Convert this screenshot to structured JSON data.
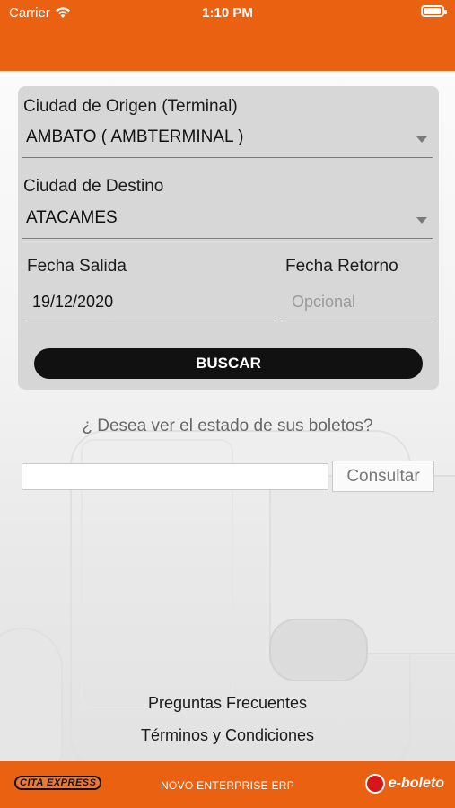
{
  "status_bar": {
    "carrier": "Carrier",
    "time": "1:10 PM",
    "battery_level": 0.95
  },
  "form": {
    "origin_label": "Ciudad de Origen (Terminal)",
    "origin_value": "AMBATO ( AMBTERMINAL )",
    "destination_label": "Ciudad de Destino",
    "destination_value": "ATACAMES",
    "departure_label": "Fecha Salida",
    "departure_value": "19/12/2020",
    "return_label": "Fecha Retorno",
    "return_placeholder": "Opcional",
    "search_button": "BUSCAR"
  },
  "ticket_status": {
    "question": "¿ Desea ver el estado de sus boletos?",
    "input_value": "",
    "button": "Consultar"
  },
  "links": {
    "faq": "Preguntas Frecuentes",
    "terms": "Términos y Condiciones"
  },
  "footer": {
    "left_logo": "CITA EXPRESS",
    "center_text": "NOVO ENTERPRISE ERP",
    "right_logo": "e-boleto"
  },
  "colors": {
    "brand_orange": "#ea6111",
    "button_black": "#111111"
  }
}
